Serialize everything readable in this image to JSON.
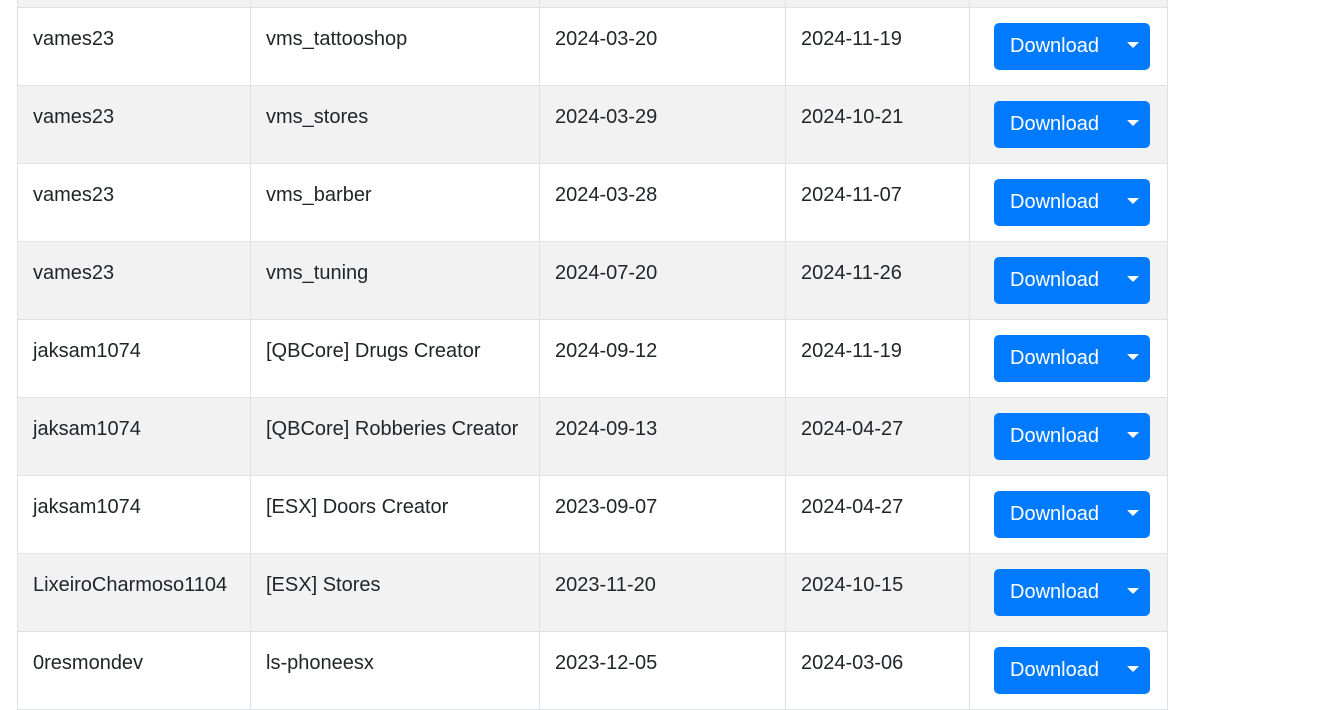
{
  "table": {
    "button_label": "Download",
    "rows": [
      {
        "author": "",
        "name": "",
        "created": "",
        "updated": "",
        "partial": true
      },
      {
        "author": "vames23",
        "name": "vms_tattooshop",
        "created": "2024-03-20",
        "updated": "2024-11-19"
      },
      {
        "author": "vames23",
        "name": "vms_stores",
        "created": "2024-03-29",
        "updated": "2024-10-21"
      },
      {
        "author": "vames23",
        "name": "vms_barber",
        "created": "2024-03-28",
        "updated": "2024-11-07"
      },
      {
        "author": "vames23",
        "name": "vms_tuning",
        "created": "2024-07-20",
        "updated": "2024-11-26"
      },
      {
        "author": "jaksam1074",
        "name": "[QBCore] Drugs Creator",
        "created": "2024-09-12",
        "updated": "2024-11-19"
      },
      {
        "author": "jaksam1074",
        "name": "[QBCore] Robberies Creator",
        "created": "2024-09-13",
        "updated": "2024-04-27"
      },
      {
        "author": "jaksam1074",
        "name": "[ESX] Doors Creator",
        "created": "2023-09-07",
        "updated": "2024-04-27"
      },
      {
        "author": "LixeiroCharmoso1104",
        "name": "[ESX] Stores",
        "created": "2023-11-20",
        "updated": "2024-10-15"
      },
      {
        "author": "0resmondev",
        "name": "ls-phoneesx",
        "created": "2023-12-05",
        "updated": "2024-03-06"
      }
    ]
  },
  "colors": {
    "button": "#007bff",
    "row_stripe": "#f2f2f2",
    "border": "#dee2e6"
  }
}
